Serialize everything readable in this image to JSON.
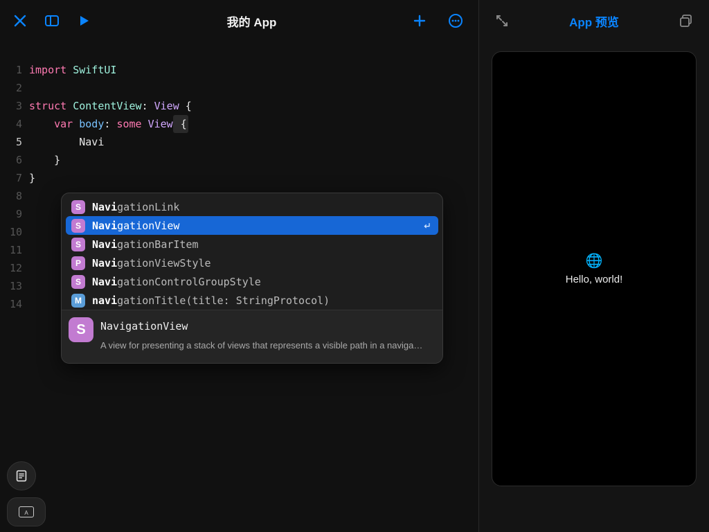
{
  "header": {
    "title": "我的 App"
  },
  "preview": {
    "title": "App 预览",
    "hello": "Hello, world!",
    "globe": "🌐"
  },
  "gutter": [
    "1",
    "2",
    "3",
    "4",
    "5",
    "6",
    "7",
    "8",
    "9",
    "10",
    "11",
    "12",
    "13",
    "14"
  ],
  "code": {
    "l1_kw": "import",
    "l1_mod": "SwiftUI",
    "l3_kw": "struct",
    "l3_name": "ContentView",
    "l3_colon": ": ",
    "l3_proto": "View",
    "l3_open": " {",
    "l4_pad": "    ",
    "l4_kw": "var",
    "l4_name": " body",
    "l4_colon": ": ",
    "l4_some": "some",
    "l4_view": " View",
    "l4_open": " {",
    "l5_pad": "        ",
    "l5_typed": "Navi",
    "l6_pad": "    ",
    "l6_close": "}",
    "l7_close": "}"
  },
  "autocomplete": {
    "match": "Navi",
    "items": [
      {
        "kind": "S",
        "rest": "gationLink"
      },
      {
        "kind": "S",
        "rest": "gationView",
        "selected": true
      },
      {
        "kind": "S",
        "rest": "gationBarItem"
      },
      {
        "kind": "P",
        "rest": "gationViewStyle"
      },
      {
        "kind": "S",
        "rest": "gationControlGroupStyle"
      },
      {
        "kind": "M",
        "rest": "gationTitle(title: StringProtocol)",
        "matchLower": true
      }
    ],
    "doc": {
      "kind": "S",
      "title": "NavigationView",
      "desc": "A view for presenting a stack of views that represents a visible path in a naviga…"
    }
  },
  "icons": {
    "close": "close-icon",
    "sidebar": "sidebar-icon",
    "run": "run-icon",
    "add": "add-icon",
    "more": "more-icon",
    "expand": "expand-icon",
    "window": "window-icon",
    "doc": "doc-icon"
  },
  "kbd_letter": "A"
}
